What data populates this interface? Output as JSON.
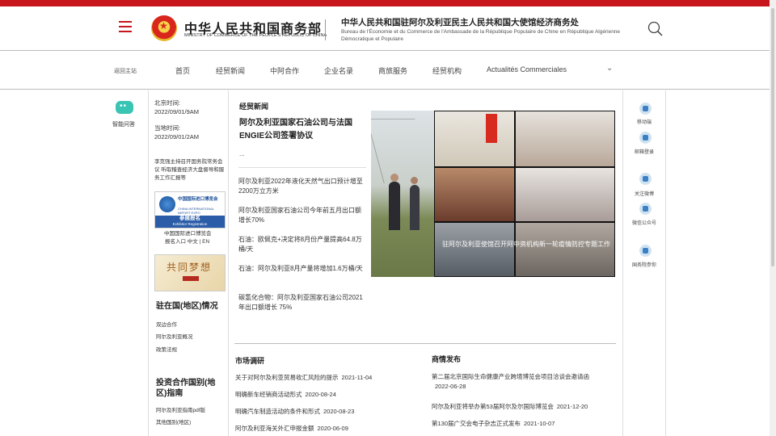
{
  "header": {
    "logo_cn": "中华人民共和国商务部",
    "logo_en": "MINISTRY OF COMMERCE OF THE PEOPLE'S REPUBLIC OF CHINA",
    "title_cn": "中华人民共和国驻阿尔及利亚民主人民共和国大使馆经济商务处",
    "title_fr": "Bureau de l'Économie et du Commerce de l'Ambassade de la République Populaire de Chine en République Algérienne Démocratique et Populaire"
  },
  "nav": {
    "back": "返回主站",
    "items": [
      "首页",
      "经贸新闻",
      "中阿合作",
      "企业名录",
      "商旅服务",
      "经贸机构",
      "Actualités Commerciales"
    ]
  },
  "left": {
    "chat": "智能问答",
    "beijing_label": "北京时间:",
    "beijing_time": "2022/09/01/9AM",
    "local_label": "当地时间:",
    "local_time": "2022/09/01/2AM",
    "notice": "李克强主持召开国务院常务会议 听取稽查经济大盘督导和服务工作汇报等",
    "expo_cn": "中国国际进口博览会",
    "expo_en": "CHINA INTERNATIONAL IMPORT EXPO",
    "expo_reg_cn": "参展报名",
    "expo_reg_en": "Exhibitor Registration",
    "expo_caption1": "中国国际进口博览会",
    "expo_caption2": "报名入口 中文 | EN",
    "dream_text": "共同梦想",
    "sec1_title": "驻在国(地区)情况",
    "sec1_items": [
      "双边合作",
      "阿尔及利亚概况",
      "政策法规"
    ],
    "sec2_title": "投资合作国别(地区)指南",
    "sec2_items": [
      "阿尔及利亚指南pdf版",
      "其他国别(地区)"
    ]
  },
  "main": {
    "section_title": "经贸新闻",
    "headline": "阿尔及利亚国家石油公司与法国ENGIE公司签署协议",
    "ellipsis": "...",
    "news": [
      "阿尔及利亚2022年液化天然气出口预计增至2200万立方米",
      "阿尔及利亚国家石油公司今年前五月出口额增长70%",
      "石油：欧佩克+决定将8月份产量提高64.8万桶/天",
      "石油：阿尔及利亚8月产量将增加1.6万桶/天",
      "碳氢化合物：阿尔及利亚国家石油公司2021年出口额增长 75%"
    ],
    "photo_caption": "驻阿尔及利亚使馆召开阿中资机构新一轮疫情防控专题工作"
  },
  "market": {
    "title": "市场调研",
    "items": [
      {
        "text": "关于对阿尔及利亚贸易收汇风险的提示",
        "date": "2021-11-04"
      },
      {
        "text": "明确新车经销商活动形式",
        "date": "2020-08-24"
      },
      {
        "text": "明确汽车制造活动的条件和形式",
        "date": "2020-08-23"
      },
      {
        "text": "阿尔及利亚海关外汇申报金额",
        "date": "2020-06-09"
      }
    ]
  },
  "business": {
    "title": "商情发布",
    "items": [
      {
        "text": "第二届北京国际生命健康产业跨境博览会项目洽谈会邀请函",
        "date": "2022-06-28"
      },
      {
        "text": "阿尔及利亚将举办第53届阿尔及尔国际博览会",
        "date": "2021-12-20"
      },
      {
        "text": "第130届广交会电子杂志正式发布",
        "date": "2021-10-07"
      }
    ]
  },
  "right": {
    "items": [
      "移动端",
      "邮箱登录",
      "关注微博",
      "微信公众号",
      "国务院参你"
    ]
  }
}
